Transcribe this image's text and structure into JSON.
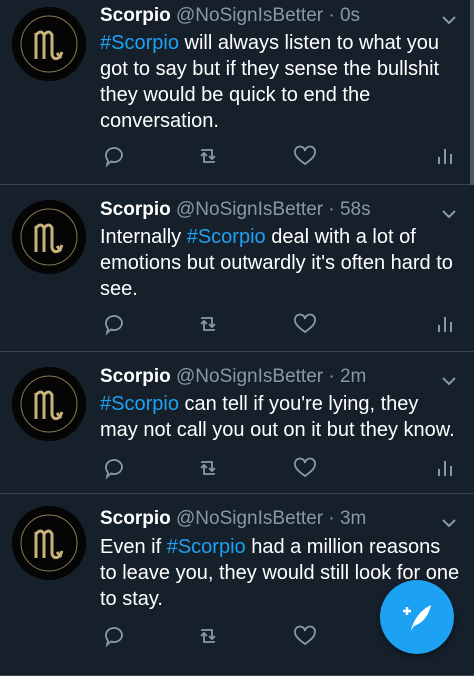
{
  "tweets": [
    {
      "name": "Scorpio",
      "handle": "@NoSignIsBetter",
      "sep": "·",
      "time": "0s",
      "pre": "",
      "hashtag": "#Scorpio",
      "post": " will always listen to what you got to say but if they sense the bullshit they would be quick to end the conversation."
    },
    {
      "name": "Scorpio",
      "handle": "@NoSignIsBetter",
      "sep": "·",
      "time": "58s",
      "pre": "Internally ",
      "hashtag": "#Scorpio",
      "post": " deal with a lot of emotions but outwardly it's often hard to see."
    },
    {
      "name": "Scorpio",
      "handle": "@NoSignIsBetter",
      "sep": "·",
      "time": "2m",
      "pre": "",
      "hashtag": "#Scorpio",
      "post": " can tell if you're lying, they may not call you out on it but they know."
    },
    {
      "name": "Scorpio",
      "handle": "@NoSignIsBetter",
      "sep": "·",
      "time": "3m",
      "pre": "Even if ",
      "hashtag": "#Scorpio",
      "post": " had a million reasons to leave you, they would still look for one to stay."
    }
  ],
  "icons": {
    "reply": "reply-icon",
    "retweet": "retweet-icon",
    "like": "heart-icon",
    "analytics": "analytics-icon",
    "menu": "chevron-down-icon",
    "compose": "compose-tweet-icon"
  },
  "colors": {
    "background": "#15202b",
    "accent": "#1da1f2",
    "muted": "#8899a6",
    "divider": "#38444d"
  }
}
